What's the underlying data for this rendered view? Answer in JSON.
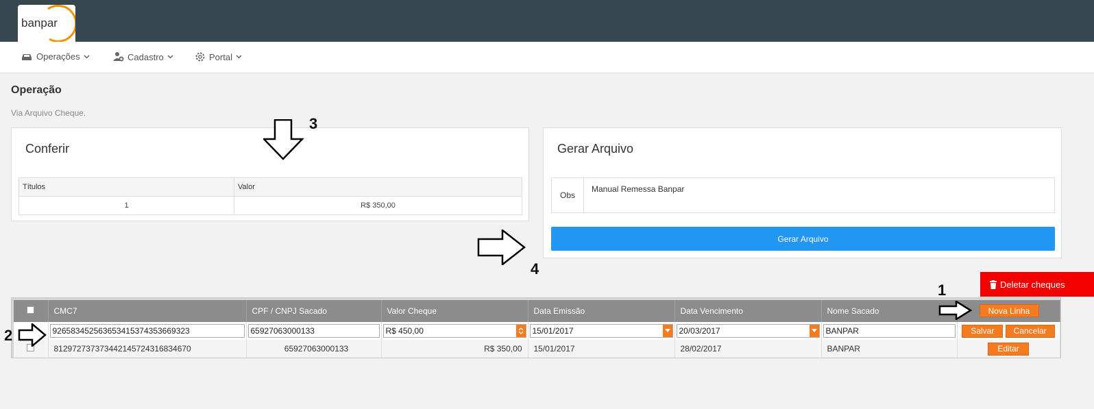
{
  "app": {
    "logo_text": "banpar"
  },
  "nav": [
    {
      "label": "Operações",
      "icon": "car-icon"
    },
    {
      "label": "Cadastro",
      "icon": "user-add-icon"
    },
    {
      "label": "Portal",
      "icon": "gear-icon"
    }
  ],
  "page": {
    "title": "Operação",
    "subtitle": "Via Arquivo Cheque."
  },
  "conferir": {
    "title": "Conferir",
    "headers": [
      "Títulos",
      "Valor"
    ],
    "row": [
      "1",
      "R$ 350,00"
    ]
  },
  "gerar": {
    "title": "Gerar Arquivo",
    "obs_label": "Obs",
    "obs_value": "Manual Remessa Banpar",
    "button": "Gerar Arquivo"
  },
  "delete_button": "Deletar cheques",
  "grid": {
    "headers": [
      "CMC7",
      "CPF / CNPJ Sacado",
      "Valor Cheque",
      "Data Emissão",
      "Data Vencimento",
      "Nome Sacado"
    ],
    "new_line_button": "Nova Linha",
    "edit_row": {
      "cmc7": "926583452563653415374353669323",
      "cpf": "65927063000133",
      "valor": "R$ 450,00",
      "emissao": "15/01/2017",
      "vencimento": "20/03/2017",
      "nome": "BANPAR",
      "save": "Salvar",
      "cancel": "Cancelar"
    },
    "rows": [
      {
        "cmc7": "812972737373442145724316834670",
        "cpf": "65927063000133",
        "valor": "R$ 350,00",
        "emissao": "15/01/2017",
        "vencimento": "28/02/2017",
        "nome": "BANPAR",
        "edit": "Editar"
      }
    ]
  },
  "annotations": [
    "1",
    "2",
    "3",
    "4"
  ],
  "colors": {
    "topbar": "#37474f",
    "primary": "#2196f3",
    "orange": "#f47b20",
    "danger": "#f20000"
  }
}
